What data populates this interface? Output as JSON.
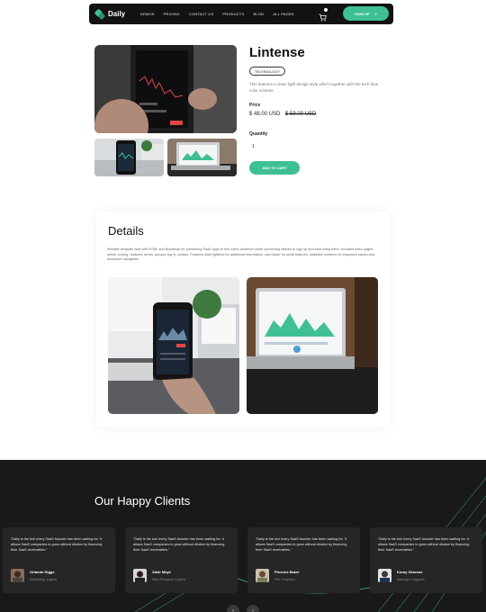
{
  "nav": {
    "logo": "Daily",
    "items": [
      "DEMOS",
      "PRICING",
      "CONTACT US",
      "PRODUCTS",
      "BLOG",
      "ALL PAGES"
    ],
    "signup_label": "SIGN UP",
    "signup_arrow": "↗"
  },
  "product": {
    "title": "Lintense",
    "tag": "TECHNOLOGY",
    "description": "This features a clean light design style which together with the tech blue color scheme",
    "price_label": "Price",
    "price": "$ 48.00 USD",
    "old_price": "$ 59.00 USD",
    "quantity_label": "Quantity",
    "quantity_value": "1",
    "add_to_cart": "ADD TO CART"
  },
  "details": {
    "title": "Details",
    "text": "Website template built with HTML and Bootstrap for presenting SaaS apps to the online audience while convincing visitors to sign up and start using them. Included extra pages: article, pricing, features, terms, privacy, log in, contact. Features slide lightbox for additional information, card slider for small features, statistics numbers for important values and dropdown navigation."
  },
  "clients": {
    "title": "Our Happy Clients",
    "testimonials": [
      {
        "quote": "\"Daily is the tool every SaaS founder has been waiting for. It allows SaaS companies to grow without dilution by financing their SaaS receivables.\"",
        "name": "Orlando Diggs",
        "role": "Marketing, Layers"
      },
      {
        "quote": "\"Daily is the tool every SaaS founder has been waiting for. It allows SaaS companies to grow without dilution by financing their SaaS receivables.\"",
        "name": "Zahir Mays",
        "role": "Web Designer, Layers"
      },
      {
        "quote": "\"Daily is the tool every SaaS founder has been waiting for. It allows SaaS companies to grow without dilution by financing their SaaS receivables.\"",
        "name": "Phoenix Baker",
        "role": "PM, Graphics"
      },
      {
        "quote": "\"Daily is the tool every SaaS founder has been waiting for. It allows SaaS companies to grow without dilution by financing their SaaS receivables.\"",
        "name": "Koray Okumus",
        "role": "Manager, Gigantic"
      }
    ]
  },
  "colors": {
    "accent": "#3fbf94",
    "dark": "#191919"
  },
  "icons": {
    "cart": "cart-icon",
    "prev": "arrow-left-icon",
    "next": "arrow-right-icon"
  }
}
